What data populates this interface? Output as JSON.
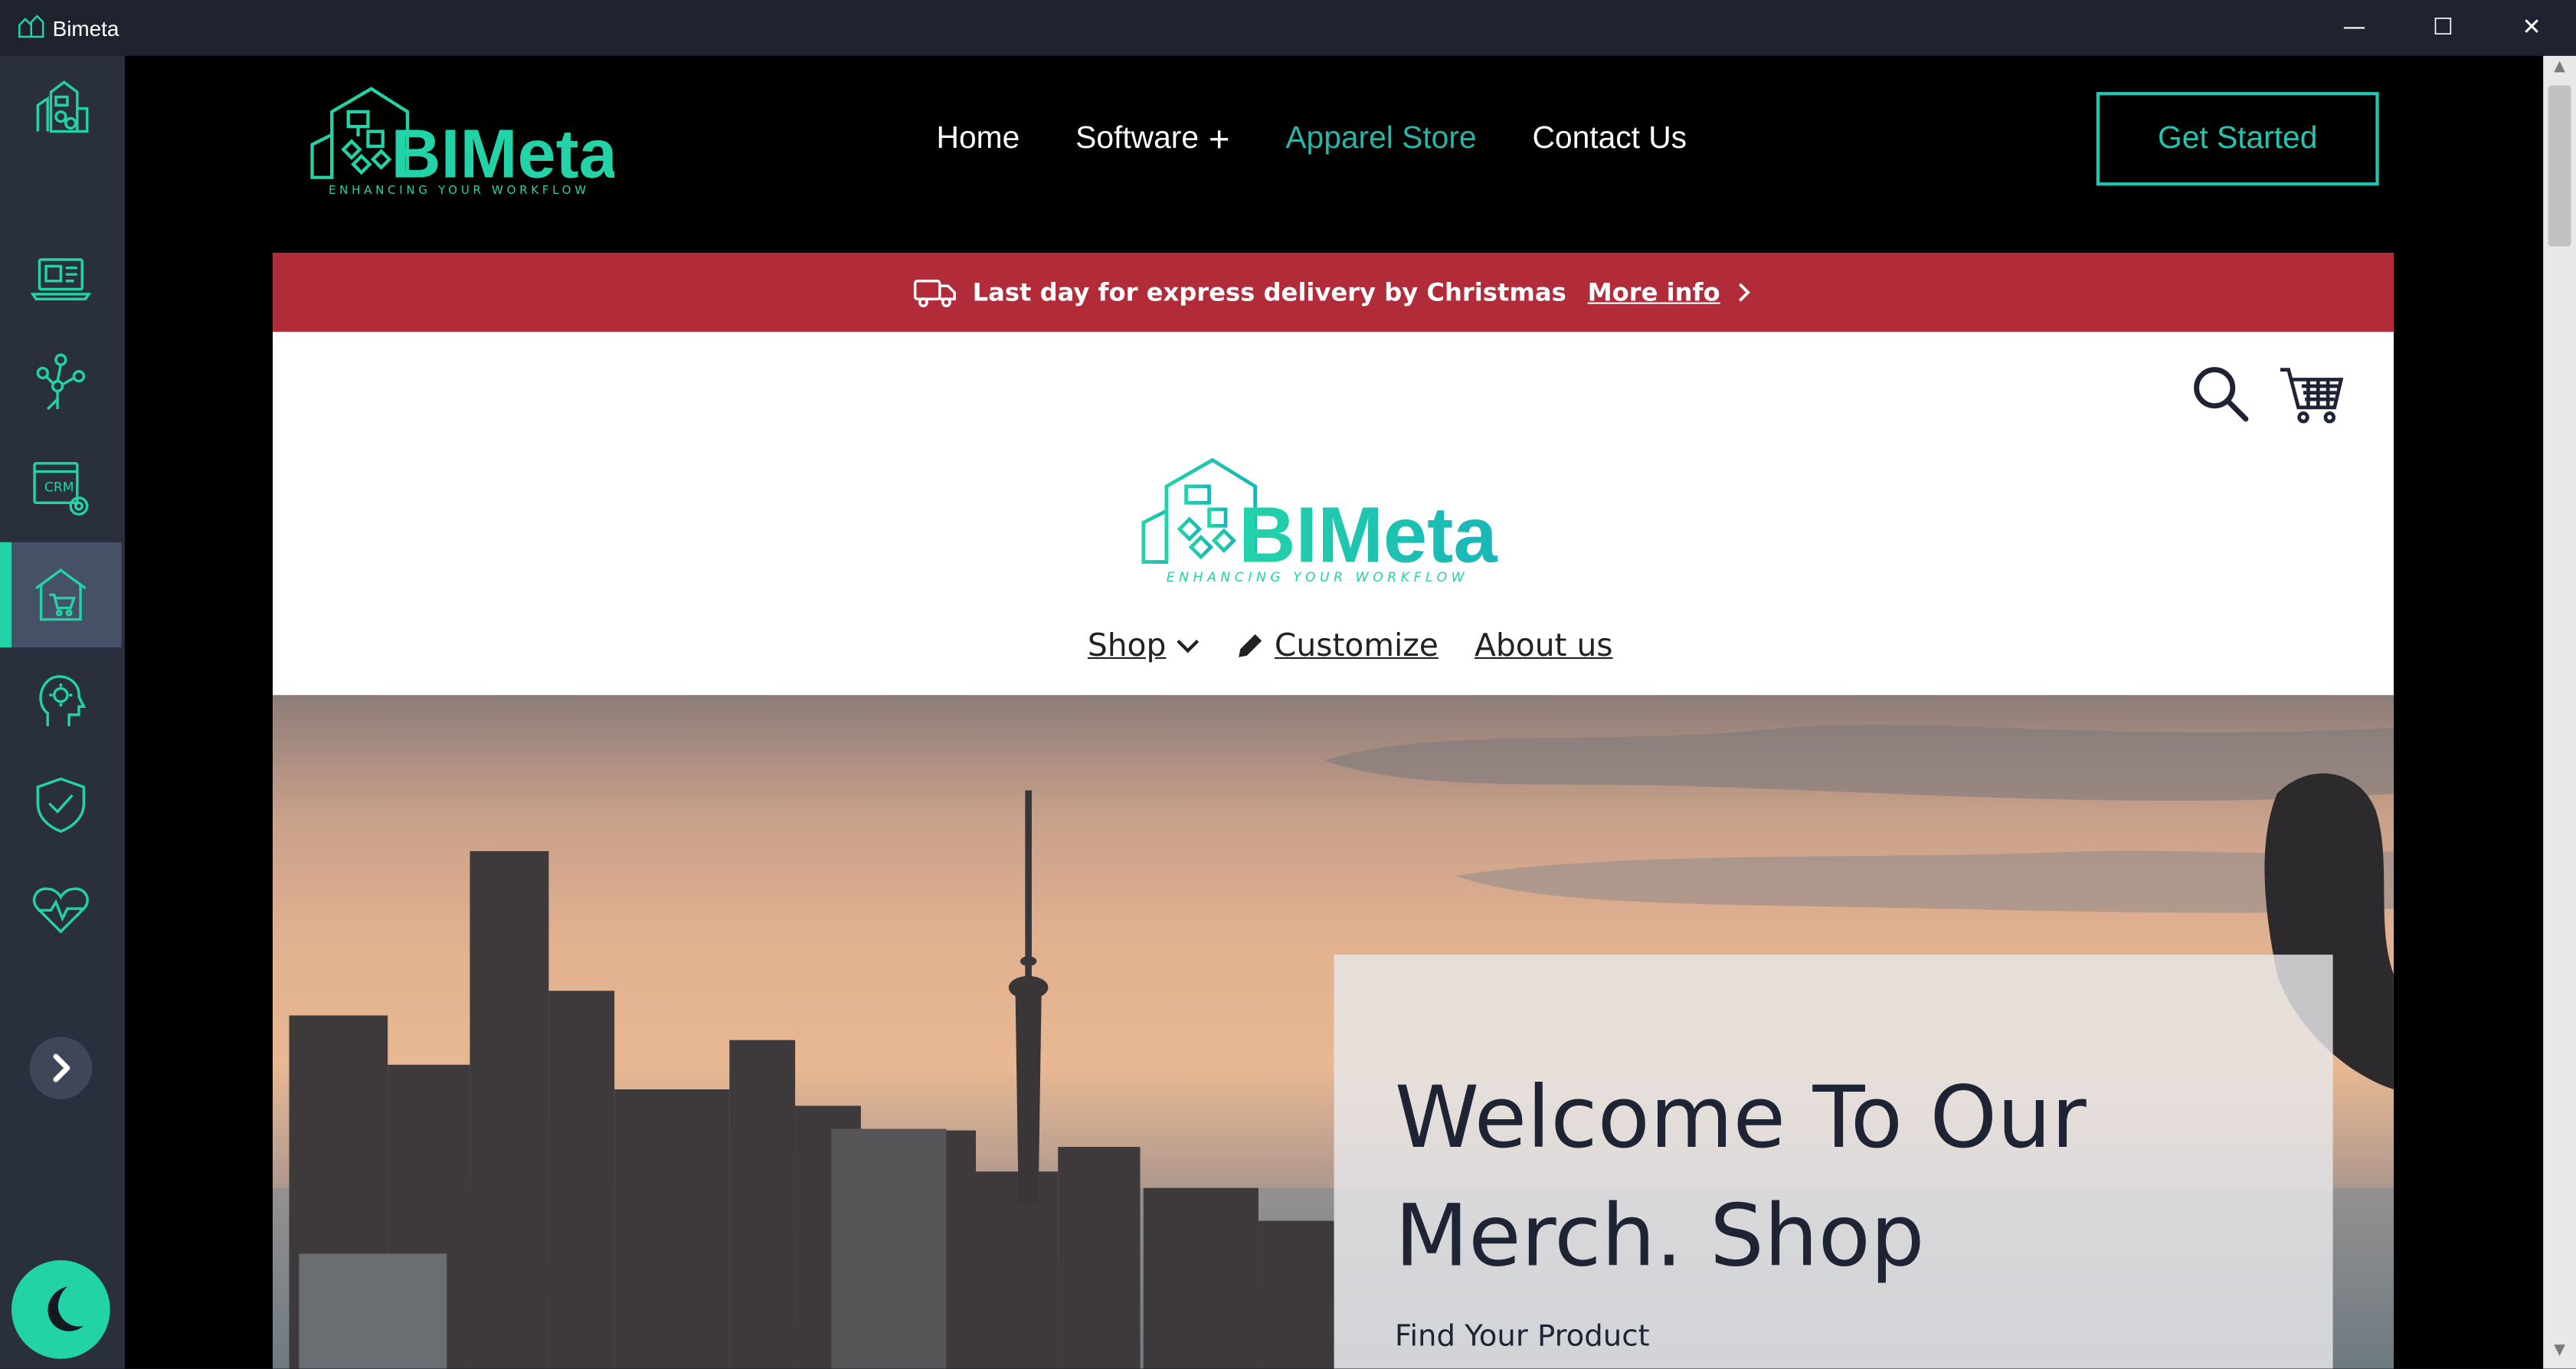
{
  "window": {
    "title": "Bimeta",
    "minimize": "—",
    "maximize": "☐",
    "close": "✕"
  },
  "sidebar": {
    "items": [
      {
        "name": "buildings",
        "icon": "buildings-icon"
      },
      {
        "name": "desktop",
        "icon": "laptop-icon"
      },
      {
        "name": "people",
        "icon": "people-network-icon"
      },
      {
        "name": "crm",
        "icon": "crm-settings-icon"
      },
      {
        "name": "store",
        "icon": "store-cart-icon",
        "active": true
      },
      {
        "name": "support",
        "icon": "support-head-icon"
      },
      {
        "name": "security",
        "icon": "shield-check-icon"
      },
      {
        "name": "health",
        "icon": "heart-pulse-icon"
      }
    ],
    "expand_icon": "chevron-right-icon",
    "theme_icon": "moon-icon",
    "accent": "#22d3a8"
  },
  "header": {
    "logo_alt": "BIMeta",
    "logo_tagline": "ENHANCING YOUR WORKFLOW",
    "nav": {
      "home": "Home",
      "software": "Software",
      "apparel": "Apparel Store",
      "contact": "Contact Us"
    },
    "cta": "Get Started",
    "accent": "#22c5b0"
  },
  "promo": {
    "text": "Last day for express delivery by Christmas",
    "link": "More info",
    "color": "#b22b38"
  },
  "store": {
    "nav": {
      "shop": "Shop",
      "customize": "Customize",
      "about": "About us"
    }
  },
  "hero": {
    "title": "Welcome To Our Merch. Shop",
    "subtitle": "Find Your Product"
  }
}
